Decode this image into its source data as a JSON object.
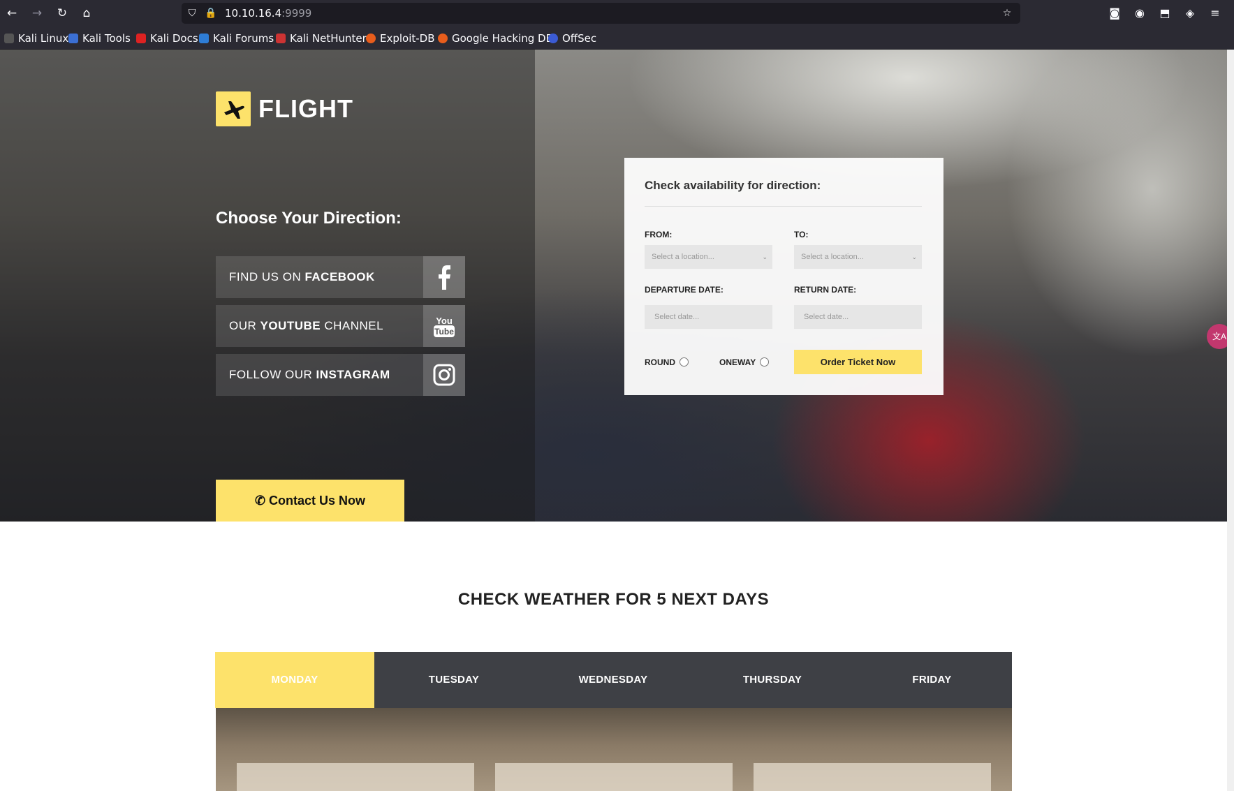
{
  "browser": {
    "url_host": "10.10.16.4",
    "url_port": ":9999",
    "bookmarks": [
      "Kali Linux",
      "Kali Tools",
      "Kali Docs",
      "Kali Forums",
      "Kali NetHunter",
      "Exploit-DB",
      "Google Hacking DB",
      "OffSec"
    ]
  },
  "brand": {
    "name": "FLIGHT"
  },
  "hero": {
    "direction_title": "Choose Your Direction:",
    "social": [
      {
        "prefix": "FIND US ON ",
        "strong": "FACEBOOK",
        "suffix": "",
        "icon": "facebook-icon"
      },
      {
        "prefix": "OUR ",
        "strong": "YOUTUBE",
        "suffix": " CHANNEL",
        "icon": "youtube-icon"
      },
      {
        "prefix": "FOLLOW OUR ",
        "strong": "INSTAGRAM",
        "suffix": "",
        "icon": "instagram-icon"
      }
    ],
    "contact_label": "Contact Us Now"
  },
  "booking": {
    "title": "Check availability for direction:",
    "from_label": "FROM:",
    "to_label": "TO:",
    "from_placeholder": "Select a location...",
    "to_placeholder": "Select a location...",
    "departure_label": "DEPARTURE DATE:",
    "return_label": "RETURN DATE:",
    "departure_placeholder": "Select date...",
    "return_placeholder": "Select date...",
    "round_label": "ROUND",
    "oneway_label": "ONEWAY",
    "order_label": "Order Ticket Now"
  },
  "weather": {
    "title": "CHECK WEATHER FOR 5 NEXT DAYS",
    "days": [
      "MONDAY",
      "TUESDAY",
      "WEDNESDAY",
      "THURSDAY",
      "FRIDAY"
    ],
    "active_day": "MONDAY"
  },
  "colors": {
    "accent": "#fde26b",
    "tab_bar": "#3e4045",
    "chrome": "#2b2a33"
  }
}
